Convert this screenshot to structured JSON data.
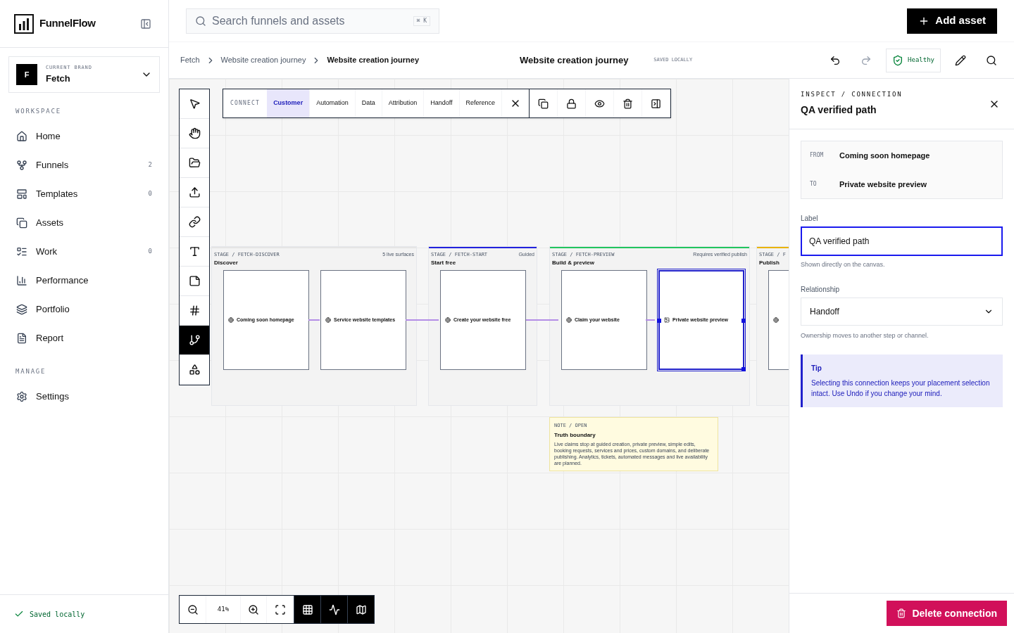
{
  "brand": {
    "name": "FunnelFlow"
  },
  "current_brand": {
    "eyebrow": "CURRENT BRAND",
    "initial": "F",
    "name": "Fetch"
  },
  "sidebar": {
    "sections": [
      {
        "title": "WORKSPACE",
        "items": [
          {
            "label": "Home",
            "selected": false
          },
          {
            "label": "Funnels",
            "count": "2",
            "selected": false
          },
          {
            "label": "Templates",
            "count": "0",
            "selected": false
          },
          {
            "label": "Assets",
            "selected": false
          },
          {
            "label": "Work",
            "count": "0",
            "selected": false
          },
          {
            "label": "Performance",
            "selected": false
          },
          {
            "label": "Portfolio",
            "selected": false
          },
          {
            "label": "Report",
            "selected": false
          }
        ]
      },
      {
        "title": "MANAGE",
        "items": [
          {
            "label": "Settings",
            "selected": false
          }
        ]
      }
    ],
    "status": "Saved locally"
  },
  "search": {
    "placeholder": "Search funnels and assets",
    "shortcut": "⌘ K"
  },
  "add_button": "Add asset",
  "breadcrumbs": [
    "Fetch",
    "Website creation journey",
    "Website creation journey"
  ],
  "doc_title": "Website creation journey",
  "save_state": "SAVED LOCALLY",
  "health": "Healthy",
  "tools": [
    {
      "selected": false
    },
    {
      "selected": false
    },
    {
      "selected": false
    },
    {
      "selected": false
    },
    {
      "selected": false
    },
    {
      "selected": false
    },
    {
      "selected": false
    },
    {
      "selected": false
    },
    {
      "selected": true
    },
    {
      "selected": false
    }
  ],
  "connect_bar": {
    "label": "CONNECT",
    "options": [
      {
        "label": "Customer",
        "selected": true
      },
      {
        "label": "Automation",
        "selected": false
      },
      {
        "label": "Data",
        "selected": false
      },
      {
        "label": "Attribution",
        "selected": false
      },
      {
        "label": "Handoff",
        "selected": false
      },
      {
        "label": "Reference",
        "selected": false
      }
    ]
  },
  "stages": [
    {
      "eyebrow": "STAGE / FETCH-DISCOVER",
      "title": "Discover",
      "tag": "5 live surfaces",
      "color": "#e5e5e5",
      "cards": [
        {
          "label": "Coming soon homepage",
          "kind": "page",
          "selected": false
        },
        {
          "label": "Service website templates",
          "kind": "page",
          "selected": false
        }
      ]
    },
    {
      "eyebrow": "STAGE / FETCH-START",
      "title": "Start free",
      "tag": "Guided",
      "color": "#2222dd",
      "cards": [
        {
          "label": "Create your website free",
          "kind": "page",
          "selected": false
        }
      ]
    },
    {
      "eyebrow": "STAGE / FETCH-PREVIEW",
      "title": "Build & preview",
      "tag": "Requires verified publish",
      "color": "#22c55e",
      "cards": [
        {
          "label": "Claim your website",
          "kind": "page",
          "selected": false
        },
        {
          "label": "Private website preview",
          "kind": "preview",
          "selected": true
        }
      ]
    },
    {
      "eyebrow": "STAGE / F",
      "title": "Publish",
      "color": "#eab308",
      "cards": [
        {
          "kind": "page",
          "selected": false
        }
      ]
    }
  ],
  "note": {
    "eyebrow": "NOTE / OPEN",
    "title": "Truth boundary",
    "body": "Live claims stop at guided creation, private preview, simple edits, booking requests, services and prices, custom domains, and deliberate publishing. Analytics, tickets, automated messages and live availability are planned."
  },
  "zoom_bar": {
    "level": "41%",
    "toggles": [
      {
        "on": true
      },
      {
        "on": true
      },
      {
        "on": true
      }
    ]
  },
  "inspector": {
    "eyebrow": "INSPECT / CONNECTION",
    "title": "QA verified path",
    "from_label": "FROM",
    "from": "Coming soon homepage",
    "to_label": "TO",
    "to": "Private website preview",
    "label_field": {
      "label": "Label",
      "value": "QA verified path",
      "help": "Shown directly on the canvas."
    },
    "relationship": {
      "label": "Relationship",
      "value": "Handoff",
      "help": "Ownership moves to another step or channel."
    },
    "tip": {
      "title": "Tip",
      "body": "Selecting this connection keeps your placement selection intact. Use Undo if you change your mind."
    },
    "delete": "Delete connection"
  }
}
